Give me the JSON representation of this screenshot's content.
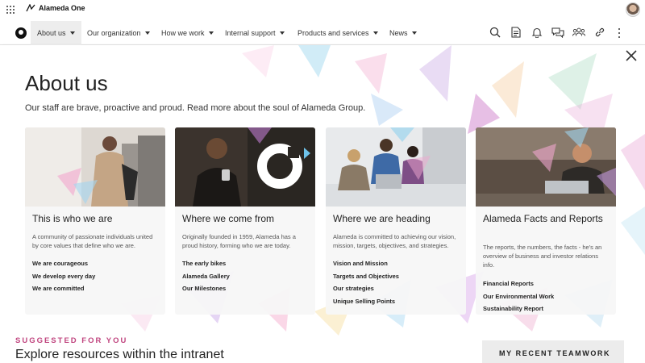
{
  "app": {
    "brand_name": "Alameda One"
  },
  "nav": {
    "items": [
      {
        "label": "About us"
      },
      {
        "label": "Our organization"
      },
      {
        "label": "How we work"
      },
      {
        "label": "Internal support"
      },
      {
        "label": "Products and services"
      },
      {
        "label": "News"
      }
    ],
    "icons": [
      "search-icon",
      "document-icon",
      "bell-icon",
      "chat-icon",
      "people-icon",
      "link-icon",
      "more-vertical-icon"
    ]
  },
  "panel": {
    "title": "About us",
    "subtitle": "Our staff are brave, proactive and proud. Read more about the soul of Alameda Group."
  },
  "cards": [
    {
      "title": "This is who we are",
      "description": "A community of passionate individuals united by core values that define who we are.",
      "links": [
        "We are courageous",
        "We develop every day",
        "We are committed"
      ]
    },
    {
      "title": "Where we come from",
      "description": "Originally founded in 1959, Alameda has a proud history, forming who we are today.",
      "links": [
        "The early bikes",
        "Alameda Gallery",
        "Our Milestones"
      ]
    },
    {
      "title": "Where we are heading",
      "description": "Alameda is committed to achieving our vision, mission, targets, objectives, and strategies.",
      "links": [
        "Vision and Mission",
        "Targets and Objectives",
        "Our strategies",
        "Unique Selling Points"
      ]
    },
    {
      "title": "Alameda Facts and Reports",
      "description": "The reports, the numbers, the facts - he's an overview of business and investor relations info.",
      "links": [
        "Financial Reports",
        "Our Environmental Work",
        "Sustainability Report"
      ]
    }
  ],
  "bottom": {
    "suggested_label": "SUGGESTED FOR YOU",
    "explore_heading": "Explore resources within the intranet",
    "teamwork_label": "MY RECENT TEAMWORK"
  },
  "colors": {
    "accent_pink": "#c0457f",
    "nav_active_bg": "#ededed"
  }
}
